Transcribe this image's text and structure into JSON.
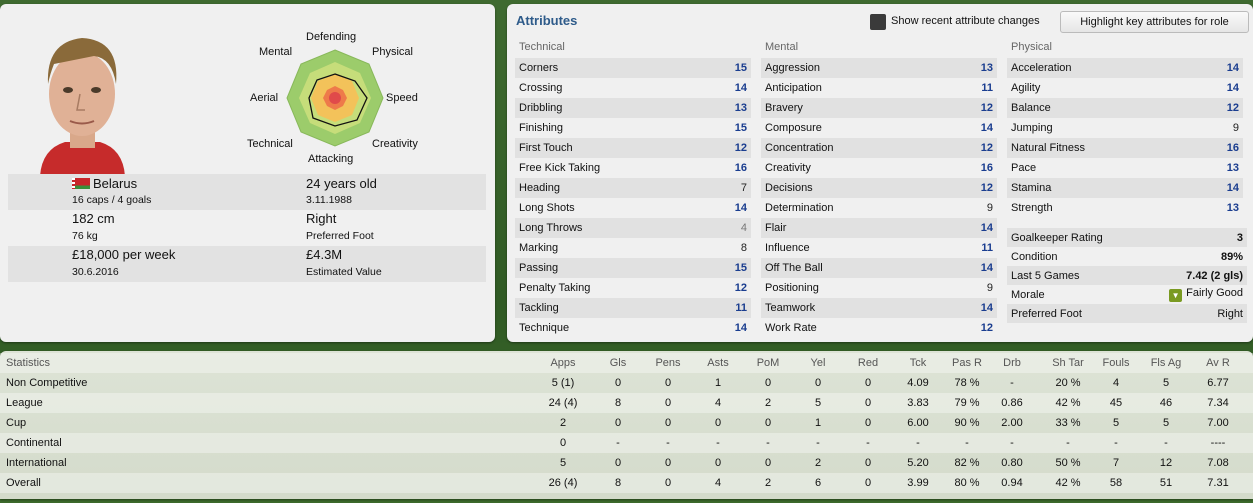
{
  "profile": {
    "radar_labels": {
      "defending": "Defending",
      "mental": "Mental",
      "physical": "Physical",
      "aerial": "Aerial",
      "speed": "Speed",
      "technical": "Technical",
      "creativity": "Creativity",
      "attacking": "Attacking"
    },
    "nationality": "Belarus",
    "caps": "16 caps / 4 goals",
    "age": "24 years old",
    "dob": "3.11.1988",
    "height": "182 cm",
    "weight": "76 kg",
    "foot": "Right",
    "foot_label": "Preferred Foot",
    "wage": "£18,000 per week",
    "contract": "30.6.2016",
    "value": "£4.3M",
    "value_label": "Estimated Value"
  },
  "attributes": {
    "title": "Attributes",
    "show_recent_label": "Show recent attribute changes",
    "highlight_label": "Highlight key attributes for role",
    "columns": [
      {
        "heading": "Technical",
        "items": [
          {
            "name": "Corners",
            "value": "15"
          },
          {
            "name": "Crossing",
            "value": "14"
          },
          {
            "name": "Dribbling",
            "value": "13"
          },
          {
            "name": "Finishing",
            "value": "15"
          },
          {
            "name": "First Touch",
            "value": "12"
          },
          {
            "name": "Free Kick Taking",
            "value": "16"
          },
          {
            "name": "Heading",
            "value": "7"
          },
          {
            "name": "Long Shots",
            "value": "14"
          },
          {
            "name": "Long Throws",
            "value": "4"
          },
          {
            "name": "Marking",
            "value": "8"
          },
          {
            "name": "Passing",
            "value": "15"
          },
          {
            "name": "Penalty Taking",
            "value": "12"
          },
          {
            "name": "Tackling",
            "value": "11"
          },
          {
            "name": "Technique",
            "value": "14"
          }
        ]
      },
      {
        "heading": "Mental",
        "items": [
          {
            "name": "Aggression",
            "value": "13"
          },
          {
            "name": "Anticipation",
            "value": "11"
          },
          {
            "name": "Bravery",
            "value": "12"
          },
          {
            "name": "Composure",
            "value": "14"
          },
          {
            "name": "Concentration",
            "value": "12"
          },
          {
            "name": "Creativity",
            "value": "16"
          },
          {
            "name": "Decisions",
            "value": "12"
          },
          {
            "name": "Determination",
            "value": "9"
          },
          {
            "name": "Flair",
            "value": "14"
          },
          {
            "name": "Influence",
            "value": "11"
          },
          {
            "name": "Off The Ball",
            "value": "14"
          },
          {
            "name": "Positioning",
            "value": "9"
          },
          {
            "name": "Teamwork",
            "value": "14"
          },
          {
            "name": "Work Rate",
            "value": "12"
          }
        ]
      },
      {
        "heading": "Physical",
        "items": [
          {
            "name": "Acceleration",
            "value": "14"
          },
          {
            "name": "Agility",
            "value": "14"
          },
          {
            "name": "Balance",
            "value": "12"
          },
          {
            "name": "Jumping",
            "value": "9"
          },
          {
            "name": "Natural Fitness",
            "value": "16"
          },
          {
            "name": "Pace",
            "value": "13"
          },
          {
            "name": "Stamina",
            "value": "14"
          },
          {
            "name": "Strength",
            "value": "13"
          }
        ]
      }
    ],
    "extras": [
      {
        "name": "Goalkeeper Rating",
        "value": "3"
      },
      {
        "name": "Condition",
        "value": "89%"
      },
      {
        "name": "Last 5 Games",
        "value": "7.42 (2 gls)"
      },
      {
        "name": "Morale",
        "value": "Fairly Good",
        "icon": "morale-icon"
      },
      {
        "name": "Preferred Foot",
        "value": "Right"
      }
    ]
  },
  "statistics": {
    "headers": [
      "Statistics",
      "Apps",
      "Gls",
      "Pens",
      "Asts",
      "PoM",
      "Yel",
      "Red",
      "Tck",
      "Pas R",
      "Drb",
      "Sh Tar",
      "Fouls",
      "Fls Ag",
      "Av R"
    ],
    "rows": [
      [
        "Non Competitive",
        "5 (1)",
        "0",
        "0",
        "1",
        "0",
        "0",
        "0",
        "4.09",
        "78 %",
        "-",
        "20 %",
        "4",
        "5",
        "6.77"
      ],
      [
        "League",
        "24 (4)",
        "8",
        "0",
        "4",
        "2",
        "5",
        "0",
        "3.83",
        "79 %",
        "0.86",
        "42 %",
        "45",
        "46",
        "7.34"
      ],
      [
        "Cup",
        "2",
        "0",
        "0",
        "0",
        "0",
        "1",
        "0",
        "6.00",
        "90 %",
        "2.00",
        "33 %",
        "5",
        "5",
        "7.00"
      ],
      [
        "Continental",
        "0",
        "-",
        "-",
        "-",
        "-",
        "-",
        "-",
        "-",
        "-",
        "-",
        "-",
        "-",
        "-",
        "----"
      ],
      [
        "International",
        "5",
        "0",
        "0",
        "0",
        "0",
        "2",
        "0",
        "5.20",
        "82 %",
        "0.80",
        "50 %",
        "7",
        "12",
        "7.08"
      ],
      [
        "Overall",
        "26 (4)",
        "8",
        "0",
        "4",
        "2",
        "6",
        "0",
        "3.99",
        "80 %",
        "0.94",
        "42 %",
        "58",
        "51",
        "7.31"
      ]
    ]
  }
}
